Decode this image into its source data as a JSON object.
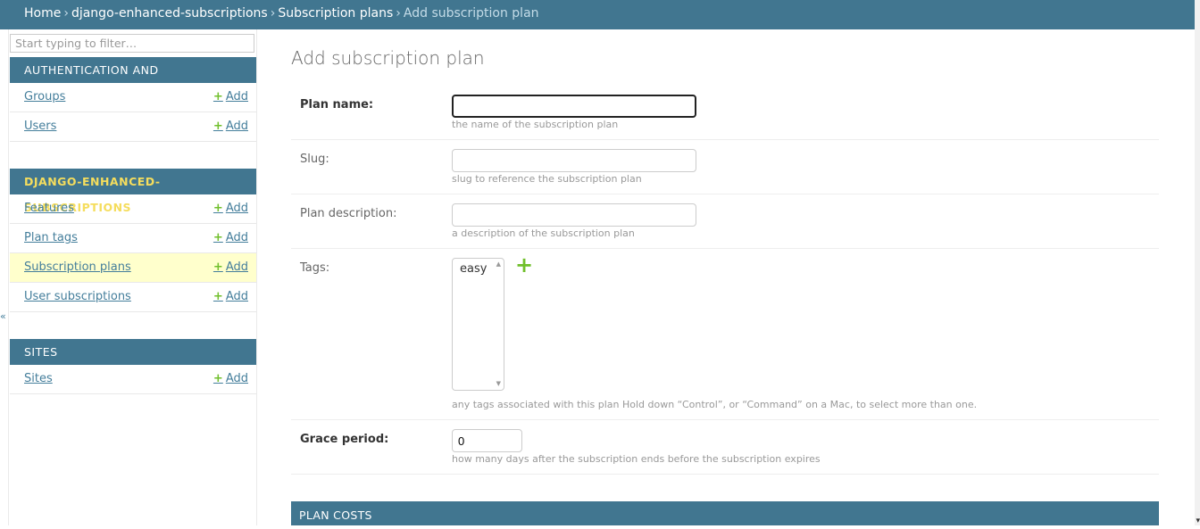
{
  "breadcrumbs": {
    "home": "Home",
    "sep": "›",
    "app": "django-enhanced-subscriptions",
    "model": "Subscription plans",
    "current": "Add subscription plan"
  },
  "sidebar": {
    "filter_placeholder": "Start typing to filter…",
    "add_label": "Add",
    "modules": [
      {
        "title": "AUTHENTICATION AND AUTHORIZATION",
        "items": [
          "Groups",
          "Users"
        ]
      },
      {
        "title": "DJANGO-ENHANCED-SUBSCRIPTIONS",
        "items": [
          "Features",
          "Plan tags",
          "Subscription plans",
          "User subscriptions"
        ]
      },
      {
        "title": "SITES",
        "items": [
          "Sites"
        ]
      }
    ],
    "collapse_glyph": "«"
  },
  "main": {
    "title": "Add subscription plan",
    "fields": {
      "plan_name": {
        "label": "Plan name:",
        "value": "",
        "help": "the name of the subscription plan"
      },
      "slug": {
        "label": "Slug:",
        "value": "",
        "help": "slug to reference the subscription plan"
      },
      "plan_description": {
        "label": "Plan description:",
        "value": "",
        "help": "a description of the subscription plan"
      },
      "tags": {
        "label": "Tags:",
        "options": [
          "easy"
        ],
        "help": "any tags associated with this plan Hold down “Control”, or “Command” on a Mac, to select more than one."
      },
      "grace_period": {
        "label": "Grace period:",
        "value": "0",
        "help": "how many days after the subscription ends before the subscription expires"
      }
    },
    "section": "PLAN COSTS"
  },
  "colors": {
    "header": "#417690",
    "link": "#447e9b",
    "add_green": "#70bf2b",
    "selected_row": "#ffffcc",
    "active_module_text": "#f5dd5d"
  }
}
